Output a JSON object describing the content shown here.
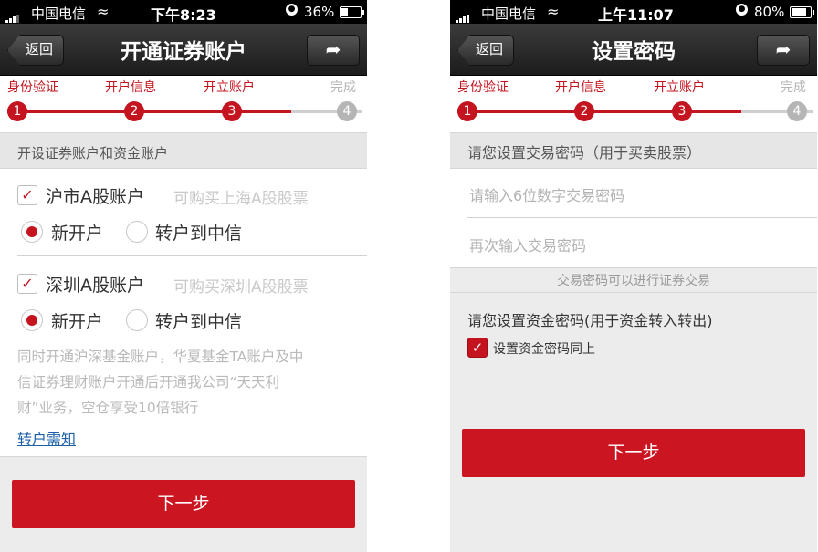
{
  "left": {
    "status": {
      "carrier": "中国电信",
      "time": "下午8:23",
      "battery": "36%",
      "battery_level": 0.36
    },
    "nav": {
      "back": "返回",
      "title": "开通证券账户"
    },
    "steps": [
      {
        "label": "身份验证",
        "num": "1"
      },
      {
        "label": "开户信息",
        "num": "2"
      },
      {
        "label": "开立账户",
        "num": "3"
      },
      {
        "label": "完成",
        "num": "4"
      }
    ],
    "section_title": "开设证券账户和资金账户",
    "sh": {
      "label": "沪市A股账户",
      "hint": "可购买上海A股股票",
      "opt_new": "新开户",
      "opt_transfer": "转户到中信"
    },
    "sz": {
      "label": "深圳A股账户",
      "hint": "可购买深圳A股股票",
      "opt_new": "新开户",
      "opt_transfer": "转户到中信"
    },
    "notice": [
      "同时开通沪深基金账户，华夏基金TA账户及中",
      "信证券理财账户开通后开通我公司“天天利",
      "财”业务，空仓享受10倍银行"
    ],
    "transfer_link": "转户需知",
    "next": "下一步"
  },
  "right": {
    "status": {
      "carrier": "中国电信",
      "time": "上午11:07",
      "battery": "80%",
      "battery_level": 0.8
    },
    "nav": {
      "back": "返回",
      "title": "设置密码"
    },
    "steps": [
      {
        "label": "身份验证",
        "num": "1"
      },
      {
        "label": "开户信息",
        "num": "2"
      },
      {
        "label": "开立账户",
        "num": "3"
      },
      {
        "label": "完成",
        "num": "4"
      }
    ],
    "trade_pwd_title": "请您设置交易密码（用于买卖股票）",
    "trade_pwd_placeholder": "请输入6位数字交易密码",
    "trade_pwd_confirm_placeholder": "再次输入交易密码",
    "trade_pwd_note": "交易密码可以进行证券交易",
    "fund_pwd_title": "请您设置资金密码(用于资金转入转出)",
    "same_pwd_label": "设置资金密码同上",
    "next": "下一步"
  },
  "colors": {
    "accent": "#c4141f",
    "inactive": "#b5b5b5"
  }
}
